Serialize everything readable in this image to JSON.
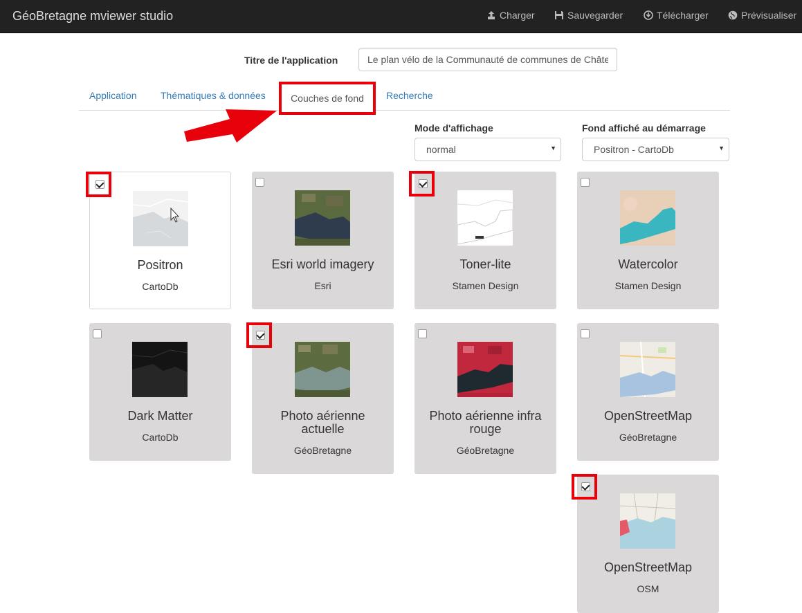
{
  "navbar": {
    "brand": "GéoBretagne mviewer studio",
    "charger": "Charger",
    "sauvegarder": "Sauvegarder",
    "telecharger": "Télécharger",
    "previsualiser": "Prévisualiser"
  },
  "app_title": {
    "label": "Titre de l'application",
    "value": "Le plan vélo de la Communauté de communes de Châte"
  },
  "tabs": [
    {
      "label": "Application"
    },
    {
      "label": "Thématiques & données"
    },
    {
      "label": "Couches de fond"
    },
    {
      "label": "Recherche"
    }
  ],
  "display_mode": {
    "label": "Mode d'affichage",
    "value": "normal"
  },
  "startup_base": {
    "label": "Fond affiché au démarrage",
    "value": "Positron - CartoDb"
  },
  "colors": {
    "highlight": "#e8000b",
    "card_bg": "#dad8d8",
    "link": "#337ab7"
  },
  "basemaps": [
    {
      "title": "Positron",
      "provider": "CartoDb",
      "checked": true,
      "thumb": "positron"
    },
    {
      "title": "Esri world imagery",
      "provider": "Esri",
      "checked": false,
      "thumb": "esri"
    },
    {
      "title": "Toner-lite",
      "provider": "Stamen Design",
      "checked": true,
      "thumb": "toner"
    },
    {
      "title": "Watercolor",
      "provider": "Stamen Design",
      "checked": false,
      "thumb": "watercolor"
    },
    {
      "title": "Dark Matter",
      "provider": "CartoDb",
      "checked": false,
      "thumb": "dark"
    },
    {
      "title": "Photo aérienne actuelle",
      "provider": "GéoBretagne",
      "checked": true,
      "thumb": "aerial"
    },
    {
      "title": "Photo aérienne infra rouge",
      "provider": "GéoBretagne",
      "checked": false,
      "thumb": "infrared"
    },
    {
      "title": "OpenStreetMap",
      "provider": "GéoBretagne",
      "checked": false,
      "thumb": "osm"
    },
    {
      "title": "OpenStreetMap",
      "provider": "OSM",
      "checked": true,
      "thumb": "osm2"
    }
  ]
}
